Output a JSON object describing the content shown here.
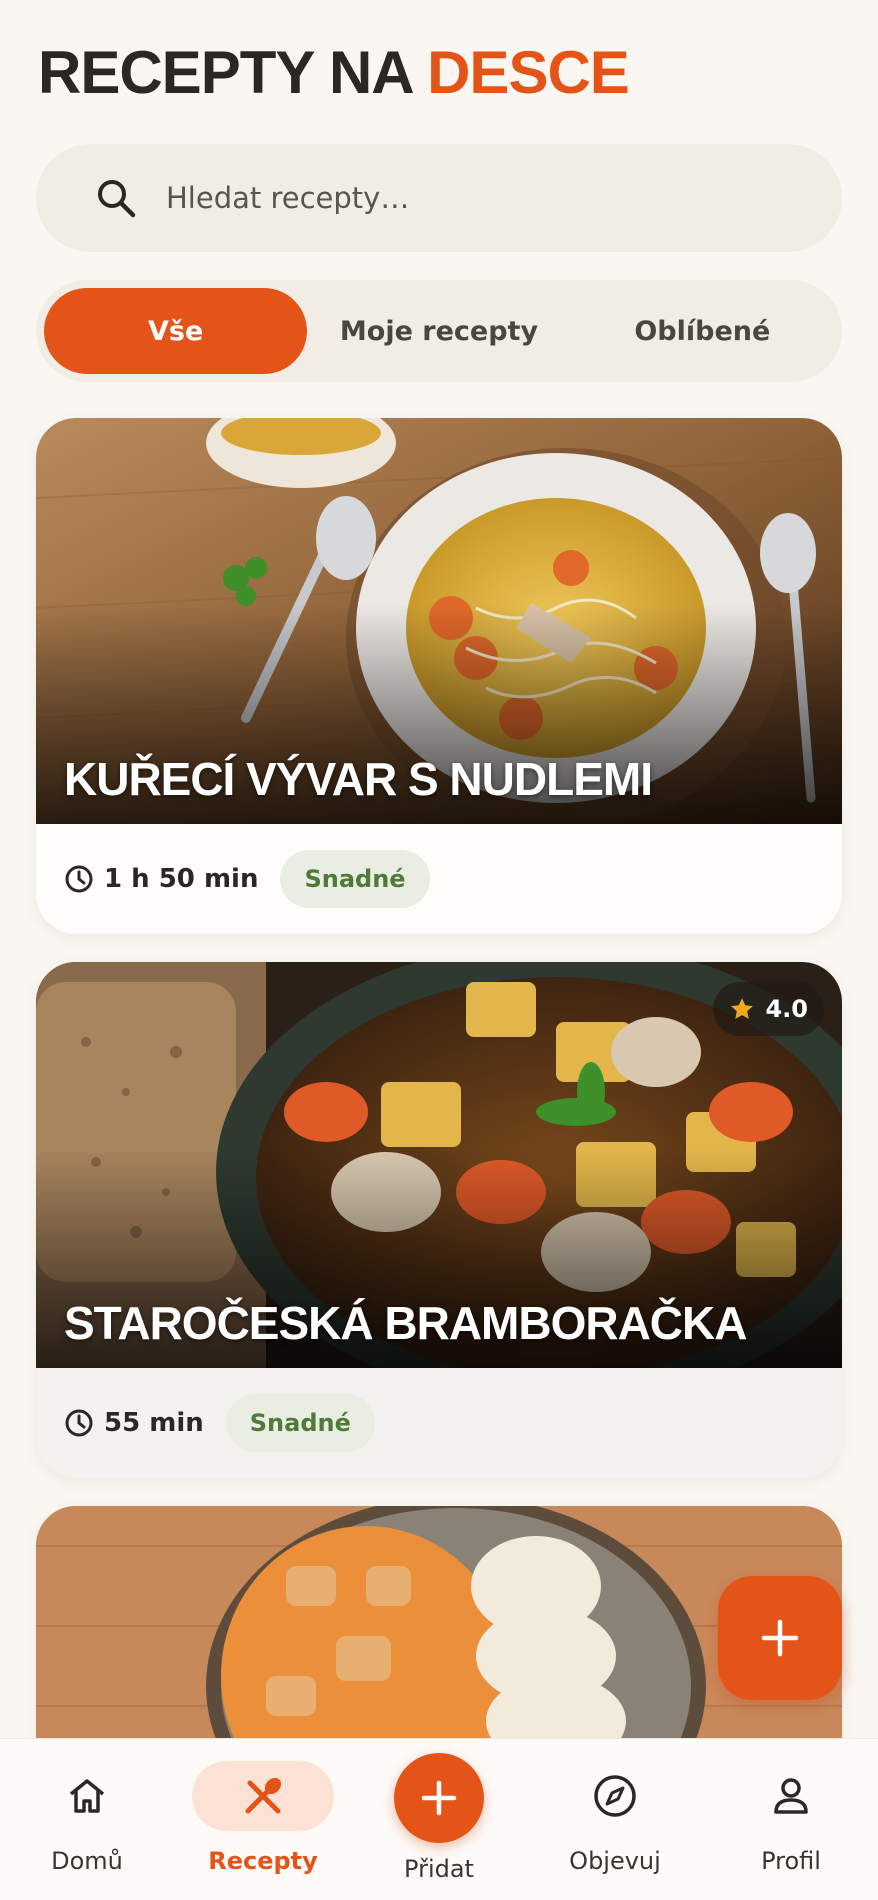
{
  "header": {
    "title_part1": "RECEPTY NA",
    "title_part2": "DESCE"
  },
  "search": {
    "placeholder": "Hledat recepty…"
  },
  "filters": {
    "tabs": [
      "Vše",
      "Moje recepty",
      "Oblíbené"
    ],
    "active": "Vše"
  },
  "recipes": [
    {
      "title": "KUŘECÍ VÝVAR S NUDLEMI",
      "time": "1 h 50 min",
      "difficulty": "Snadné"
    },
    {
      "title": "STAROČESKÁ BRAMBORAČKA",
      "time": "55 min",
      "difficulty": "Snadné",
      "rating": "4.0"
    },
    {
      "title": "",
      "time": "",
      "difficulty": ""
    }
  ],
  "nav": {
    "items": [
      "Domů",
      "Recepty",
      "Přidat",
      "Objevuj",
      "Profil"
    ],
    "active": "Recepty"
  },
  "colors": {
    "accent": "#e45418",
    "background": "#faf7f2",
    "badge_green": "#4f7a37"
  },
  "icons": {
    "search": "search-icon",
    "clock": "clock-icon",
    "star": "star-icon",
    "plus": "plus-icon",
    "home": "home-icon",
    "utensils": "fork-knife-icon",
    "compass": "compass-icon",
    "person": "person-icon"
  }
}
